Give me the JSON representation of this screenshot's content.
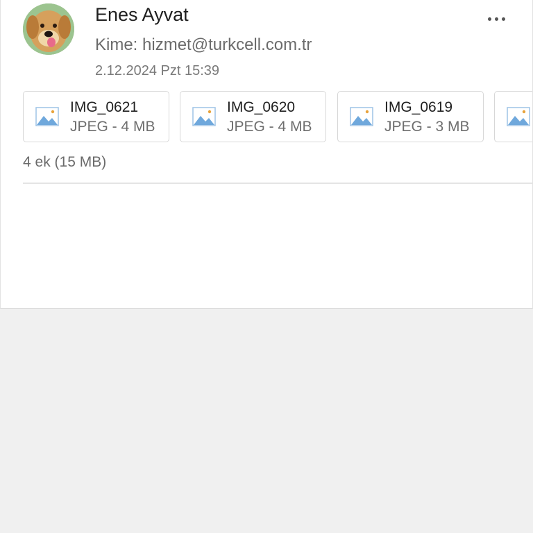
{
  "message": {
    "sender": "Enes Ayvat",
    "recipient": "Kime: hizmet@turkcell.com.tr",
    "date": "2.12.2024 Pzt 15:39",
    "avatar_icon": "dog-photo-avatar",
    "more_icon": "more-horizontal-icon"
  },
  "attachments": [
    {
      "name": "IMG_0621",
      "meta": "JPEG - 4 MB",
      "icon": "image-file-icon"
    },
    {
      "name": "IMG_0620",
      "meta": "JPEG - 4 MB",
      "icon": "image-file-icon"
    },
    {
      "name": "IMG_0619",
      "meta": "JPEG - 3 MB",
      "icon": "image-file-icon"
    },
    {
      "name": "",
      "meta": "",
      "icon": "image-file-icon"
    }
  ],
  "attachment_count": "4 ek (15 MB)",
  "colors": {
    "page_background": "#f0f0f0",
    "card_background": "#ffffff",
    "image_icon": "#6fa8dc",
    "sun_icon": "#e8a33c"
  }
}
